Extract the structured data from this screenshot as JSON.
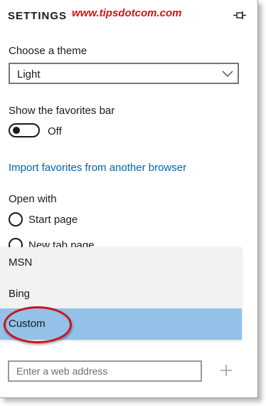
{
  "header": {
    "title": "SETTINGS",
    "watermark": "www.tipsdotcom.com",
    "pin_icon": "pin-icon"
  },
  "theme": {
    "label": "Choose a theme",
    "selected": "Light",
    "icon": "chevron-down-icon"
  },
  "favorites_bar": {
    "label": "Show the favorites bar",
    "toggle_state": "Off",
    "is_on": false
  },
  "import_link": "Import favorites from another browser",
  "open_with": {
    "label": "Open with",
    "options": [
      "Start page",
      "New tab page"
    ]
  },
  "dropdown": {
    "options": [
      "MSN",
      "Bing",
      "Custom"
    ],
    "selected": "Custom"
  },
  "web_address": {
    "placeholder": "Enter a web address",
    "value": "",
    "add_icon": "plus-icon"
  },
  "colors": {
    "link": "#0063b1",
    "selected_option": "#93c1e8",
    "dropdown_bg": "#f2f2f2",
    "annotation": "#c9151c",
    "watermark": "#d81212"
  }
}
